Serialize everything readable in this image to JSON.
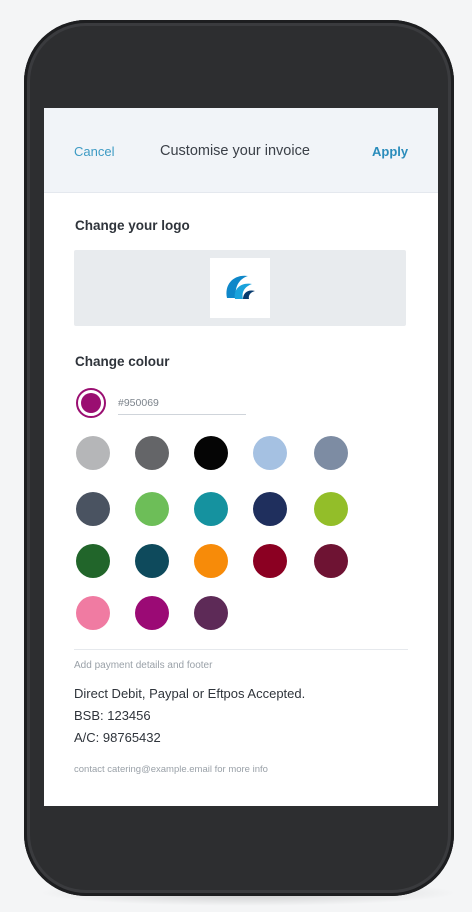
{
  "header": {
    "cancel_label": "Cancel",
    "title": "Customise your invoice",
    "apply_label": "Apply"
  },
  "logo_section": {
    "label": "Change your logo",
    "logo_icon": "wave-logo-icon"
  },
  "colour_section": {
    "label": "Change colour",
    "selected_colour": "#9a0e71",
    "hex_value": "#950069",
    "swatches": [
      "#b5b6b8",
      "#646568",
      "#050505",
      "#a5c1e2",
      "#7d8ca3",
      "#4a5361",
      "#6dbe58",
      "#15929f",
      "#1f2f5d",
      "#93be29",
      "#21652a",
      "#0e4a5c",
      "#f78b09",
      "#8b0022",
      "#6e1333",
      "#f07ba2",
      "#9b0a75",
      "#5d2a57"
    ]
  },
  "footer_section": {
    "hint": "Add payment details and footer",
    "line1": "Direct Debit, Paypal or Eftpos Accepted.",
    "line2": "BSB: 123456",
    "line3": "A/C: 98765432",
    "contact": "contact catering@example.email for more info"
  },
  "colors": {
    "accent": "#2a8cbb",
    "phone_body": "#2d2e30",
    "header_bg": "#f1f4f8"
  }
}
